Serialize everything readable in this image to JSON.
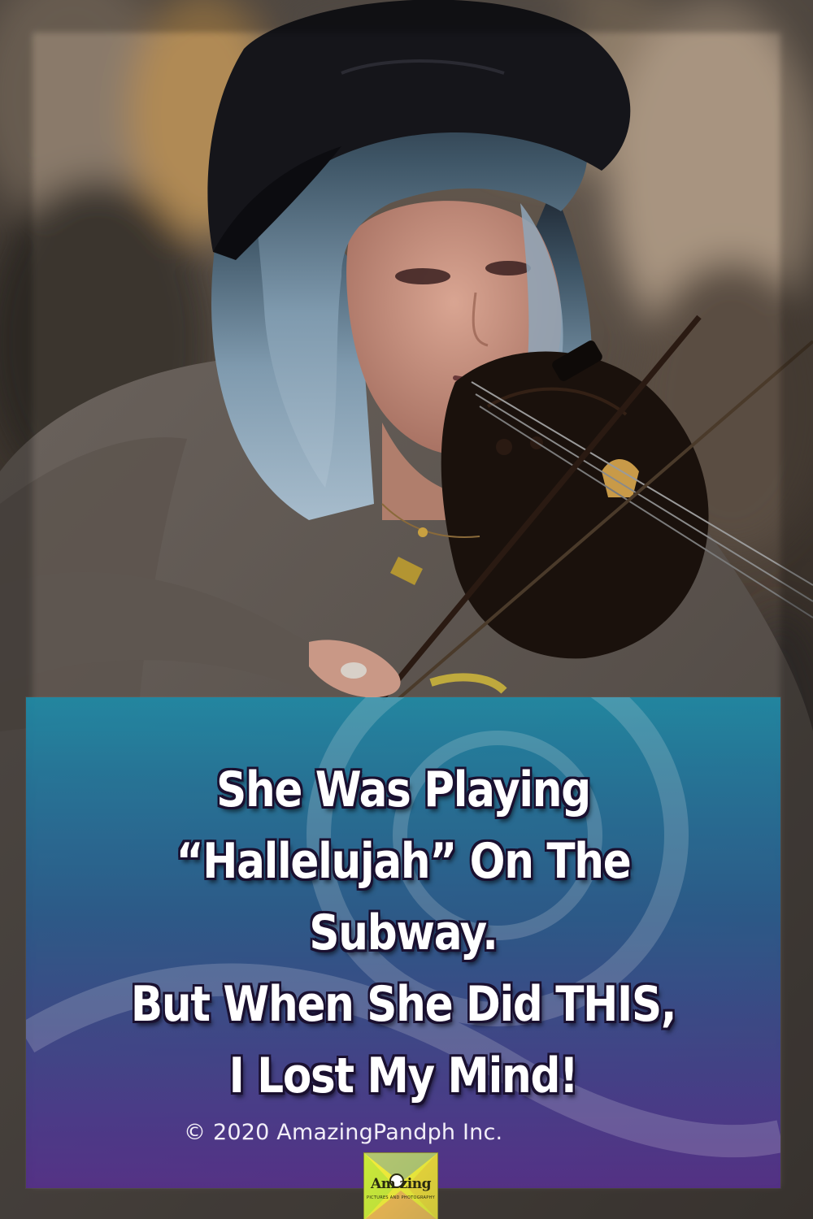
{
  "headline": {
    "line1": "She Was Playing",
    "line2": "“Hallelujah” On The Subway.",
    "line3": "But When She Did THIS,",
    "line4": "I Lost My Mind!"
  },
  "copyright": "© 2020 AmazingPandph Inc.",
  "logo": {
    "wordmark": "Am zing",
    "tagline": "PICTURES AND PHOTOGRAPHY"
  },
  "colors": {
    "panel_top": "#1f8aa6",
    "panel_bottom": "#55308a",
    "headline_text": "#ffffff",
    "headline_outline": "#1a1030",
    "logo_background": "#f6ee3a"
  }
}
